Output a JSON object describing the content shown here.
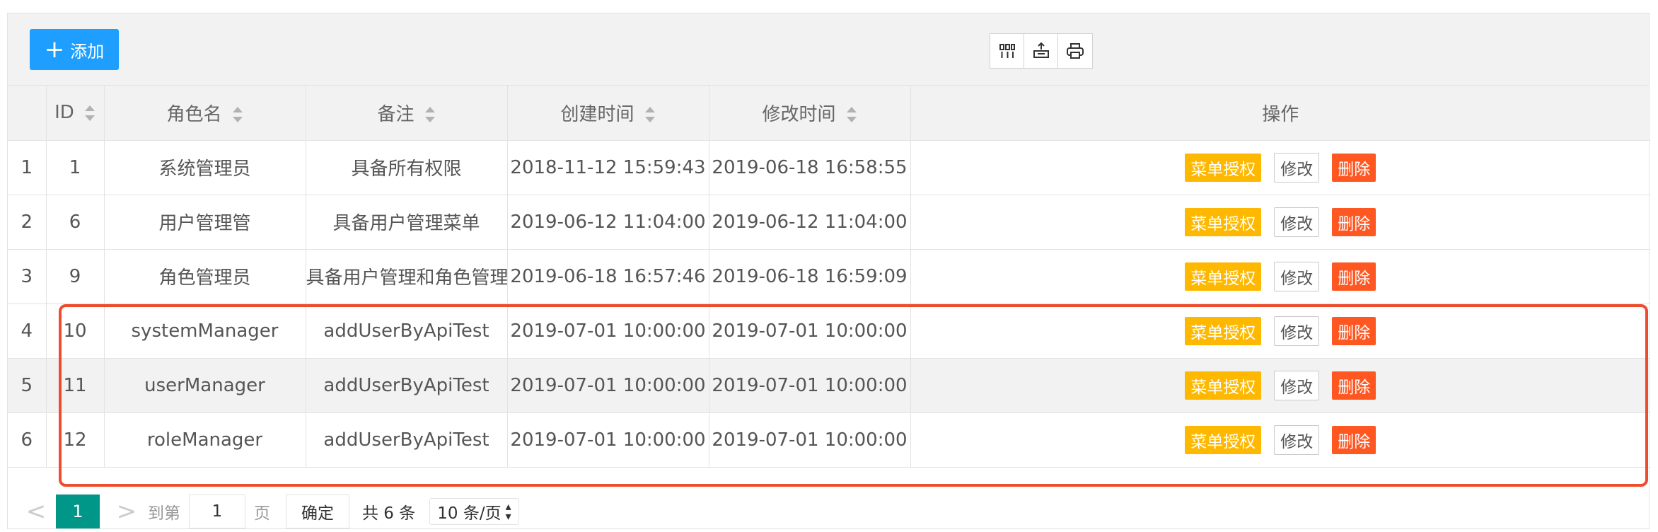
{
  "toolbar": {
    "add_label": "添加",
    "icons": [
      "columns-icon",
      "export-icon",
      "print-icon"
    ]
  },
  "table": {
    "headers": {
      "index": "",
      "id": "ID",
      "role_name": "角色名",
      "remark": "备注",
      "created_at": "创建时间",
      "updated_at": "修改时间",
      "actions": "操作"
    },
    "rows": [
      {
        "index": "1",
        "id": "1",
        "role_name": "系统管理员",
        "remark": "具备所有权限",
        "created_at": "2018-11-12 15:59:43",
        "updated_at": "2019-06-18 16:58:55"
      },
      {
        "index": "2",
        "id": "6",
        "role_name": "用户管理管",
        "remark": "具备用户管理菜单",
        "created_at": "2019-06-12 11:04:00",
        "updated_at": "2019-06-12 11:04:00"
      },
      {
        "index": "3",
        "id": "9",
        "role_name": "角色管理员",
        "remark": "具备用户管理和角色管理菜单",
        "created_at": "2019-06-18 16:57:46",
        "updated_at": "2019-06-18 16:59:09"
      },
      {
        "index": "4",
        "id": "10",
        "role_name": "systemManager",
        "remark": "addUserByApiTest",
        "created_at": "2019-07-01 10:00:00",
        "updated_at": "2019-07-01 10:00:00"
      },
      {
        "index": "5",
        "id": "11",
        "role_name": "userManager",
        "remark": "addUserByApiTest",
        "created_at": "2019-07-01 10:00:00",
        "updated_at": "2019-07-01 10:00:00"
      },
      {
        "index": "6",
        "id": "12",
        "role_name": "roleManager",
        "remark": "addUserByApiTest",
        "created_at": "2019-07-01 10:00:00",
        "updated_at": "2019-07-01 10:00:00"
      }
    ],
    "action_labels": {
      "authorize": "菜单授权",
      "edit": "修改",
      "delete": "删除"
    }
  },
  "pager": {
    "prev": "<",
    "current_page": "1",
    "next": ">",
    "goto_label": "到第",
    "goto_value": "1",
    "page_unit": "页",
    "confirm": "确定",
    "total": "共 6 条",
    "page_size": "10 条/页"
  },
  "colors": {
    "primary": "#1e9fff",
    "authorize": "#ffb800",
    "delete": "#ff5722",
    "current_page": "#009688",
    "highlight_border": "#ee4c2c"
  }
}
